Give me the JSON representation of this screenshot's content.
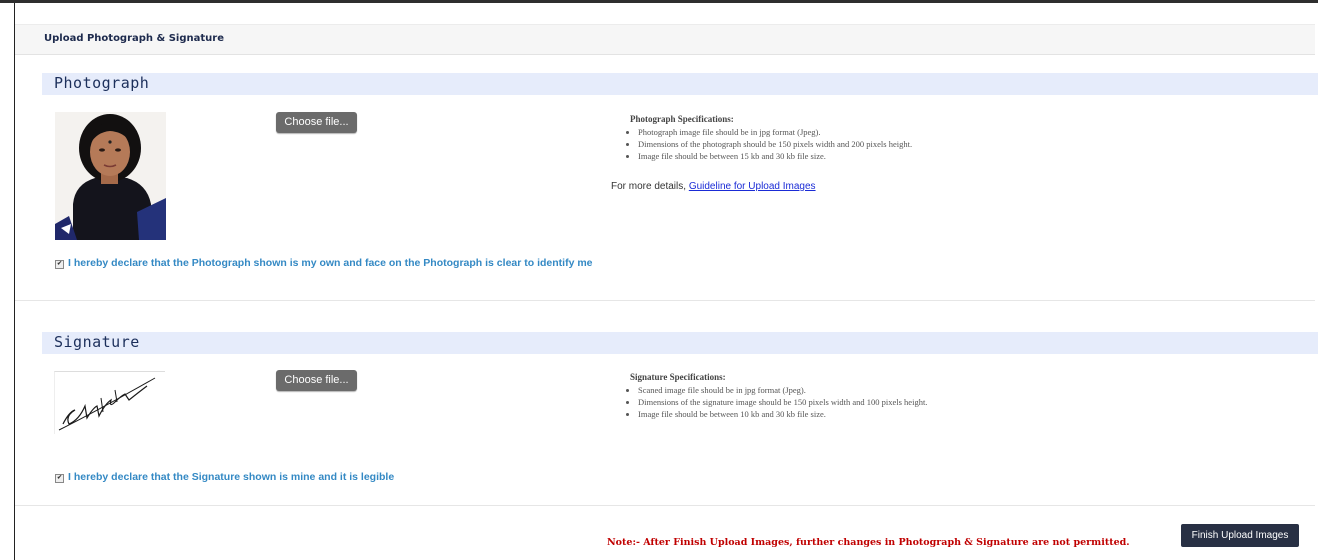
{
  "page": {
    "title": "Upload Photograph & Signature"
  },
  "photograph": {
    "heading": "Photograph",
    "choose_label": "Choose file...",
    "spec_title": "Photograph Specifications:",
    "specs": [
      "Photograph image file should be in jpg format (Jpeg).",
      "Dimensions of the photograph should be 150 pixels width and 200 pixels height.",
      "Image file should be between 15 kb and 30 kb file size."
    ],
    "more_prefix": "For more details,",
    "more_link": "Guideline for Upload Images",
    "declaration": "I hereby declare that the Photograph shown is my own and face on the Photograph is clear to identify me",
    "declaration_checked": true
  },
  "signature": {
    "heading": "Signature",
    "choose_label": "Choose file...",
    "spec_title": "Signature Specifications:",
    "specs": [
      "Scaned image file should be in jpg format (Jpeg).",
      "Dimensions of the signature image should be 150 pixels width and 100 pixels height.",
      "Image file should be between 10 kb and 30 kb file size."
    ],
    "declaration": "I hereby declare that the Signature shown is mine and it is legible",
    "declaration_checked": true
  },
  "footer": {
    "note": "Note:- After Finish Upload Images, further changes in Photograph & Signature are not permitted.",
    "finish_label": "Finish Upload Images"
  }
}
